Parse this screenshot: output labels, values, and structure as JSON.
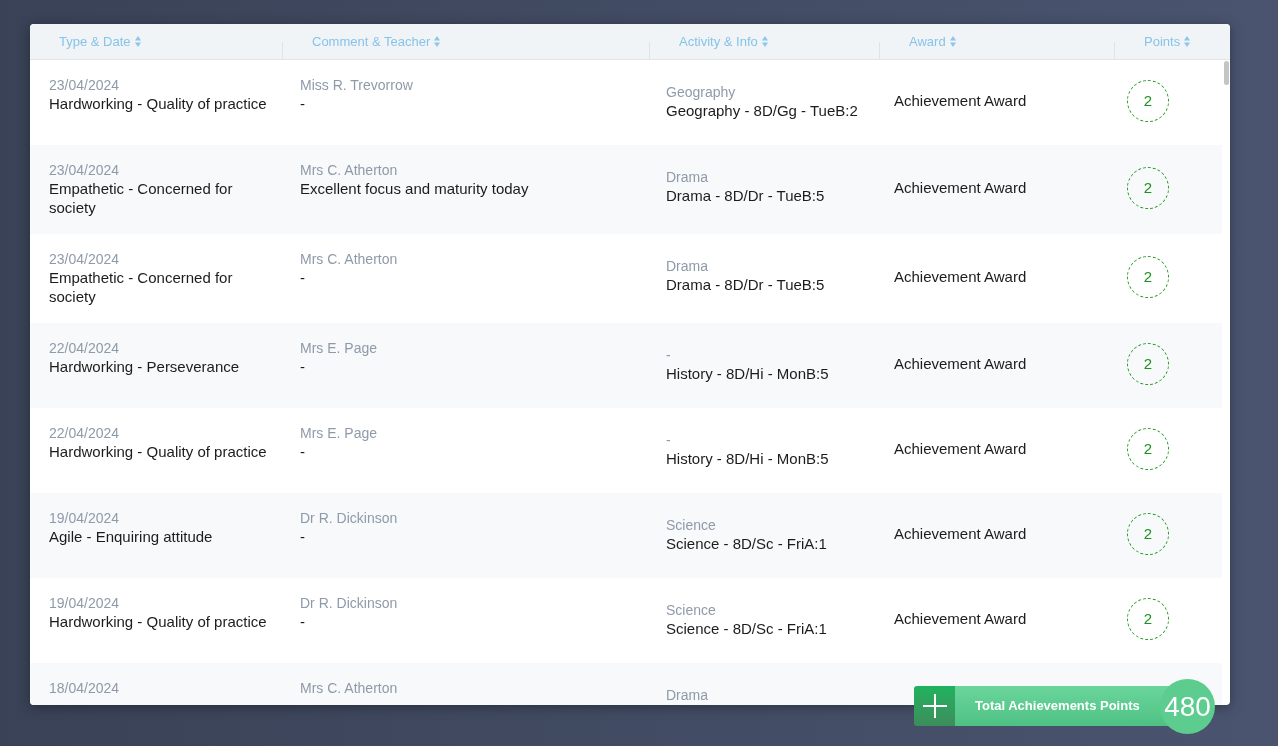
{
  "table": {
    "columns": [
      {
        "label": "Type & Date"
      },
      {
        "label": "Comment & Teacher"
      },
      {
        "label": "Activity & Info"
      },
      {
        "label": "Award"
      },
      {
        "label": "Points"
      }
    ],
    "rows": [
      {
        "date": "23/04/2024",
        "type": "Hardworking - Quality of practice",
        "teacher": "Miss R. Trevorrow",
        "comment": "-",
        "subject": "Geography",
        "lesson": "Geography - 8D/Gg - TueB:2",
        "award": "Achievement Award",
        "points": "2"
      },
      {
        "date": "23/04/2024",
        "type": "Empathetic - Concerned for society",
        "teacher": "Mrs C. Atherton",
        "comment": "Excellent focus and maturity today",
        "subject": "Drama",
        "lesson": "Drama - 8D/Dr - TueB:5",
        "award": "Achievement Award",
        "points": "2"
      },
      {
        "date": "23/04/2024",
        "type": "Empathetic - Concerned for society",
        "teacher": "Mrs C. Atherton",
        "comment": "-",
        "subject": "Drama",
        "lesson": "Drama - 8D/Dr - TueB:5",
        "award": "Achievement Award",
        "points": "2"
      },
      {
        "date": "22/04/2024",
        "type": "Hardworking - Perseverance",
        "teacher": "Mrs E. Page",
        "comment": "-",
        "subject": "-",
        "lesson": "History - 8D/Hi - MonB:5",
        "award": "Achievement Award",
        "points": "2"
      },
      {
        "date": "22/04/2024",
        "type": "Hardworking - Quality of practice",
        "teacher": "Mrs E. Page",
        "comment": "-",
        "subject": "-",
        "lesson": "History - 8D/Hi - MonB:5",
        "award": "Achievement Award",
        "points": "2"
      },
      {
        "date": "19/04/2024",
        "type": "Agile - Enquiring attitude",
        "teacher": "Dr R. Dickinson",
        "comment": "-",
        "subject": "Science",
        "lesson": "Science - 8D/Sc - FriA:1",
        "award": "Achievement Award",
        "points": "2"
      },
      {
        "date": "19/04/2024",
        "type": "Hardworking - Quality of practice",
        "teacher": "Dr R. Dickinson",
        "comment": "-",
        "subject": "Science",
        "lesson": "Science - 8D/Sc - FriA:1",
        "award": "Achievement Award",
        "points": "2"
      },
      {
        "date": "18/04/2024",
        "teacher": "Mrs C. Atherton",
        "subject": "Drama"
      }
    ]
  },
  "total": {
    "label": "Total Achievements Points",
    "value": "480"
  }
}
